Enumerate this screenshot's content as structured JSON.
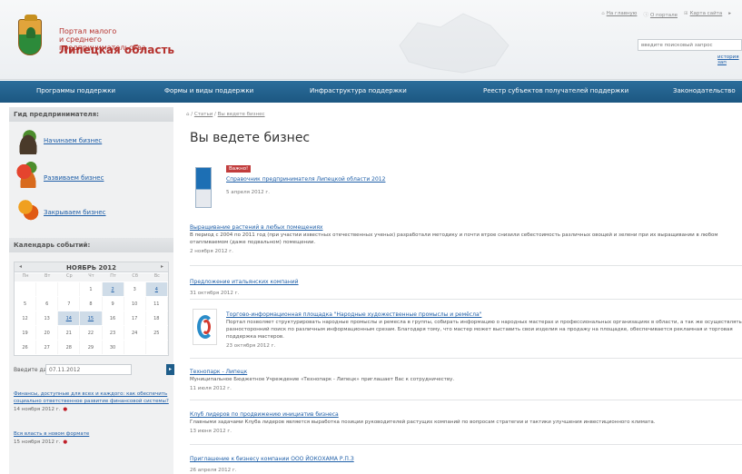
{
  "header": {
    "brand_line1": "Портал малого\nи среднего предпринимательства",
    "brand_line2": "Липецкая область",
    "top_links": [
      {
        "label": "На главную"
      },
      {
        "label": "О портале"
      },
      {
        "label": "Карта сайта"
      }
    ],
    "search_placeholder": "введите поисковый запрос",
    "advanced_search": "история зап"
  },
  "nav": {
    "items": [
      {
        "label": "Программы поддержки"
      },
      {
        "label": "Формы и виды поддержки"
      },
      {
        "label": "Инфраструктура поддержки"
      },
      {
        "label": "Реестр субъектов получателей поддержки"
      },
      {
        "label": "Законодательство"
      }
    ]
  },
  "sidebar": {
    "guide_title": "Гид предпринимателя:",
    "guide_items": [
      {
        "label": "Начинаем бизнес"
      },
      {
        "label": "Развиваем бизнес"
      },
      {
        "label": "Закрываем бизнес"
      }
    ],
    "calendar_title": "Календарь событий:",
    "calendar": {
      "month": "НОЯБРЬ 2012",
      "prev": "◂",
      "next": "▸",
      "weekdays": [
        "Пн",
        "Вт",
        "Ср",
        "Чт",
        "Пт",
        "Сб",
        "Вс"
      ],
      "weeks": [
        [
          "",
          "",
          "",
          "1",
          "2",
          "3",
          "4"
        ],
        [
          "5",
          "6",
          "7",
          "8",
          "9",
          "10",
          "11"
        ],
        [
          "12",
          "13",
          "14",
          "15",
          "16",
          "17",
          "18"
        ],
        [
          "19",
          "20",
          "21",
          "22",
          "23",
          "24",
          "25"
        ],
        [
          "26",
          "27",
          "28",
          "29",
          "30",
          "",
          ""
        ]
      ],
      "highlighted": [
        "2",
        "4",
        "14",
        "15"
      ]
    },
    "date_label": "Введите дату:",
    "date_value": "07.11.2012",
    "date_go": "▸",
    "events": [
      {
        "title": "Финансы, доступные для всех и каждого: как обеспечить социально ответственное развитие финансовой системы?",
        "date": "14 ноября 2012 г."
      },
      {
        "title": "Вся власть в новом формате",
        "date": "15 ноября 2012 г."
      }
    ]
  },
  "content": {
    "breadcrumb_home": "Статьи",
    "breadcrumb_current": "Вы ведете бизнес",
    "title": "Вы ведете бизнес",
    "featured": {
      "badge": "Важно!",
      "title": "Справочник предпринимателя Липецкой области 2012",
      "date": "5 апреля 2012 г."
    },
    "articles": [
      {
        "title": "Выращивание растений в любых помещениях",
        "text": "В период с 2004 по 2011 год (при участии известных отечественных ученых) разработали методику и почти втрое снизили себестоимость различных овощей и зелени при их выращивании в любом отапливаемом (даже подвальном) помещении.",
        "date": "2 ноября 2012 г."
      },
      {
        "title": "Предложение итальянских компаний",
        "text": "",
        "date": "31 октября 2012 г."
      },
      {
        "title": "Торгово-информационная площадка \"Народные художественные промыслы и ремёсла\"",
        "text": "Портал позволяет структурировать народные промыслы и ремесла в группы, собирать информацию о народных мастерах и профессиональных организациях в области, а так же осуществлять разносторонний поиск по различным информационным срезам. Благодаря тому, что мастер может выставить свои изделия на продажу на площадке, обеспечивается рекламная и торговая поддержка мастеров.",
        "date": "23 октября 2012 г."
      },
      {
        "title": "Технопарк - Липецк",
        "text": "Муниципальное Бюджетное Учреждение «Технопарк - Липецк» приглашает Вас к сотрудничеству.",
        "date": "11 июля 2012 г."
      },
      {
        "title": "Клуб лидеров по продвижению инициатив бизнеса",
        "text": "Главными задачами Клуба лидеров является выработка позиции руководителей растущих компаний по вопросам стратегии и тактики улучшения инвестиционного климата.",
        "date": "13 июня 2012 г."
      },
      {
        "title": "Приглашение к бизнесу компании ООО ЙОКОХАМА Р.П.З",
        "text": "",
        "date": "26 апреля 2012 г."
      }
    ]
  }
}
